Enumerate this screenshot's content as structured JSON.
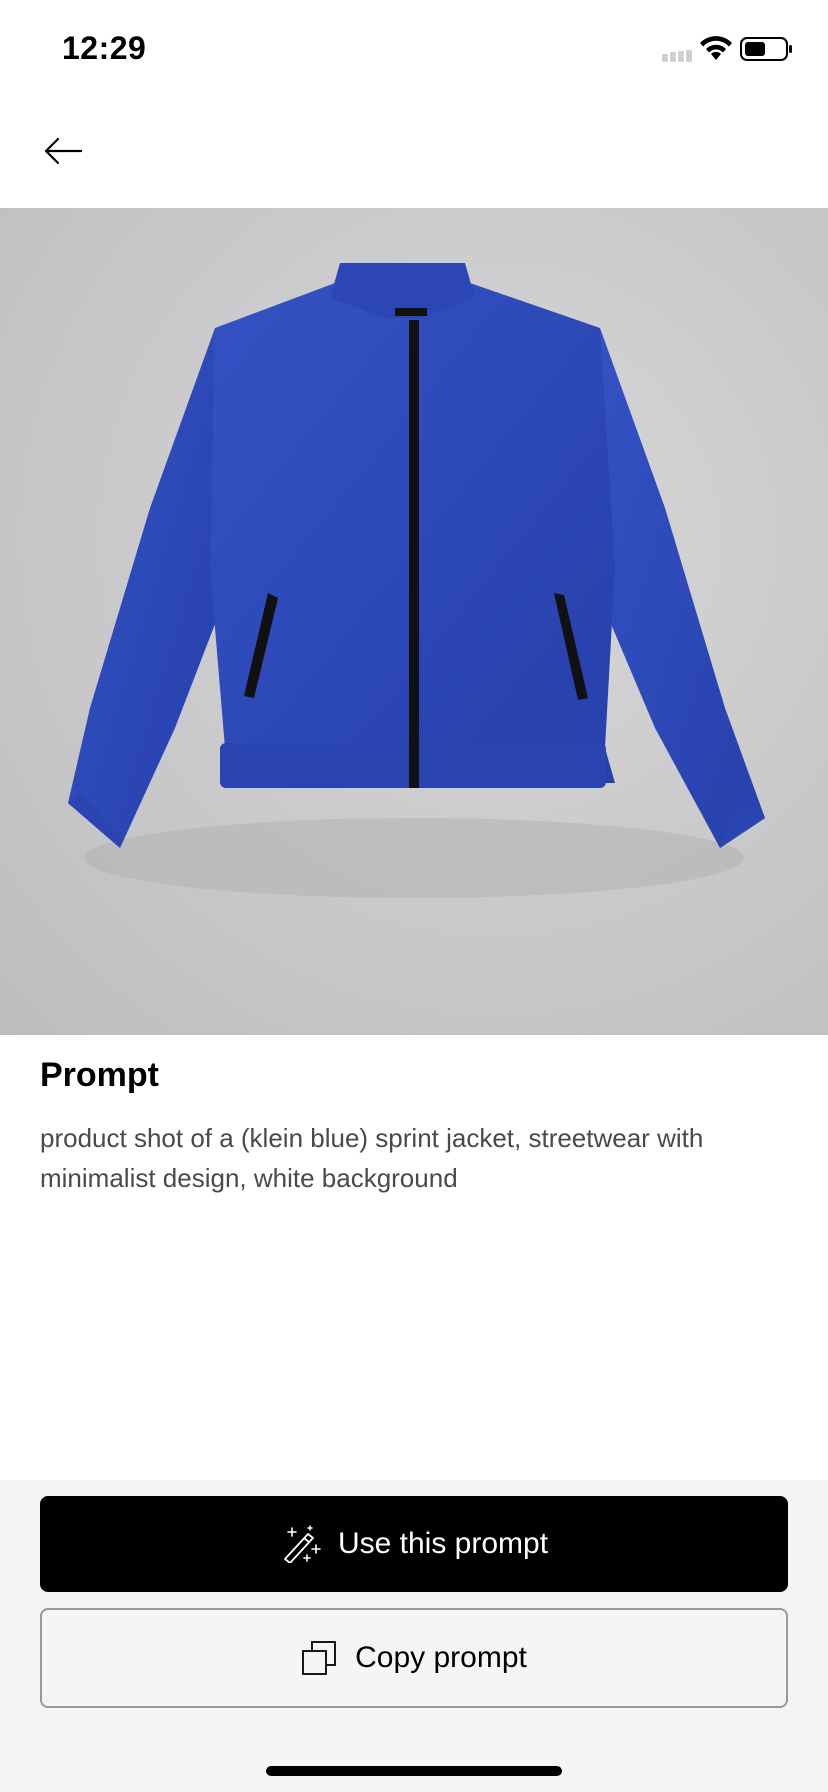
{
  "status_bar": {
    "time": "12:29"
  },
  "navigation": {
    "back_icon": "arrow-left-icon"
  },
  "hero_image": {
    "subject": "product-photo-blue-jacket",
    "background_color": "#cbcbcd",
    "jacket_color": "#2b47b8",
    "expand_icon": "expand-icon",
    "download_icon": "download-icon"
  },
  "prompt_section": {
    "heading": "Prompt",
    "text": "product shot of a (klein blue) sprint jacket, streetwear with minimalist design, white background"
  },
  "actions": {
    "use_prompt_label": "Use this prompt",
    "use_prompt_icon": "magic-wand-icon",
    "copy_prompt_label": "Copy prompt",
    "copy_prompt_icon": "copy-icon"
  },
  "colors": {
    "primary_button": "#000000",
    "primary_button_text": "#ffffff",
    "body_text": "#4a4a4a",
    "panel_background": "#f5f5f5"
  }
}
